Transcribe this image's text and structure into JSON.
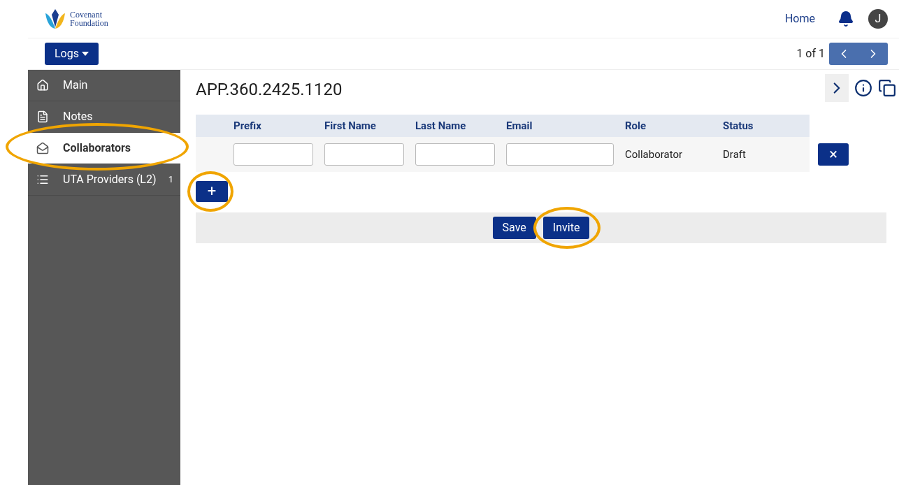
{
  "header": {
    "logo_line1": "Covenant",
    "logo_line2": "Foundation",
    "home_link": "Home",
    "avatar_initial": "J"
  },
  "toolbar": {
    "logs_button": "Logs",
    "pager": "1 of 1"
  },
  "sidebar": {
    "items": [
      {
        "label": "Main",
        "selected": false,
        "highlighted": false
      },
      {
        "label": "Notes",
        "selected": false,
        "highlighted": false
      },
      {
        "label": "Collaborators",
        "selected": true,
        "highlighted": true
      },
      {
        "label": "UTA Providers (L2)",
        "selected": false,
        "highlighted": false,
        "count": "1"
      }
    ]
  },
  "page": {
    "title": "APP.360.2425.1120"
  },
  "table": {
    "columns": [
      "Prefix",
      "First Name",
      "Last Name",
      "Email",
      "Role",
      "Status"
    ],
    "rows": [
      {
        "role": "Collaborator",
        "status": "Draft",
        "delete_label": "×"
      }
    ]
  },
  "add_button": {
    "label": "+",
    "highlighted": true
  },
  "actions": [
    {
      "label": "Save",
      "highlighted": false
    },
    {
      "label": "Invite",
      "highlighted": true
    }
  ]
}
